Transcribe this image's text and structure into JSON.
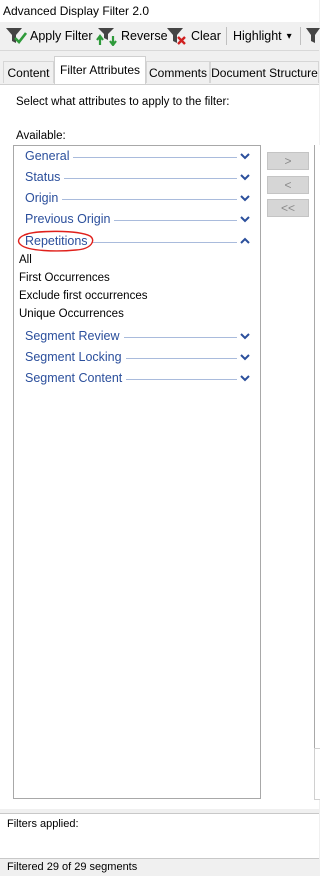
{
  "window": {
    "title": "Advanced Display Filter 2.0"
  },
  "toolbar": {
    "apply_filter": "Apply Filter",
    "reverse": "Reverse",
    "clear": "Clear",
    "highlight": "Highlight",
    "highlight_caret": "▾"
  },
  "tabs": [
    {
      "label": "Content",
      "active": false
    },
    {
      "label": "Filter Attributes",
      "active": true
    },
    {
      "label": "Comments",
      "active": false
    },
    {
      "label": "Document Structure",
      "active": false
    }
  ],
  "filter_attributes": {
    "prompt": "Select what attributes to apply to the filter:",
    "available_label": "Available:",
    "groups_top": [
      {
        "label": "General",
        "expanded": false
      },
      {
        "label": "Status",
        "expanded": false
      },
      {
        "label": "Origin",
        "expanded": false
      },
      {
        "label": "Previous Origin",
        "expanded": false
      },
      {
        "label": "Repetitions",
        "expanded": true
      }
    ],
    "repetition_items": [
      "All",
      "First Occurrences",
      "Exclude first occurrences",
      "Unique Occurrences"
    ],
    "groups_bottom": [
      {
        "label": "Segment Review",
        "expanded": false
      },
      {
        "label": "Segment Locking",
        "expanded": false
      },
      {
        "label": "Segment Content",
        "expanded": false
      }
    ],
    "buttons": {
      "add": ">",
      "remove": "<",
      "remove_all": "<<"
    }
  },
  "footer": {
    "filters_applied_label": "Filters applied:",
    "status": "Filtered 29 of 29 segments"
  },
  "colors": {
    "group_text": "#2b4f9c",
    "annotation": "#e0201b",
    "toolbar_icon_green": "#3a9a3a"
  }
}
